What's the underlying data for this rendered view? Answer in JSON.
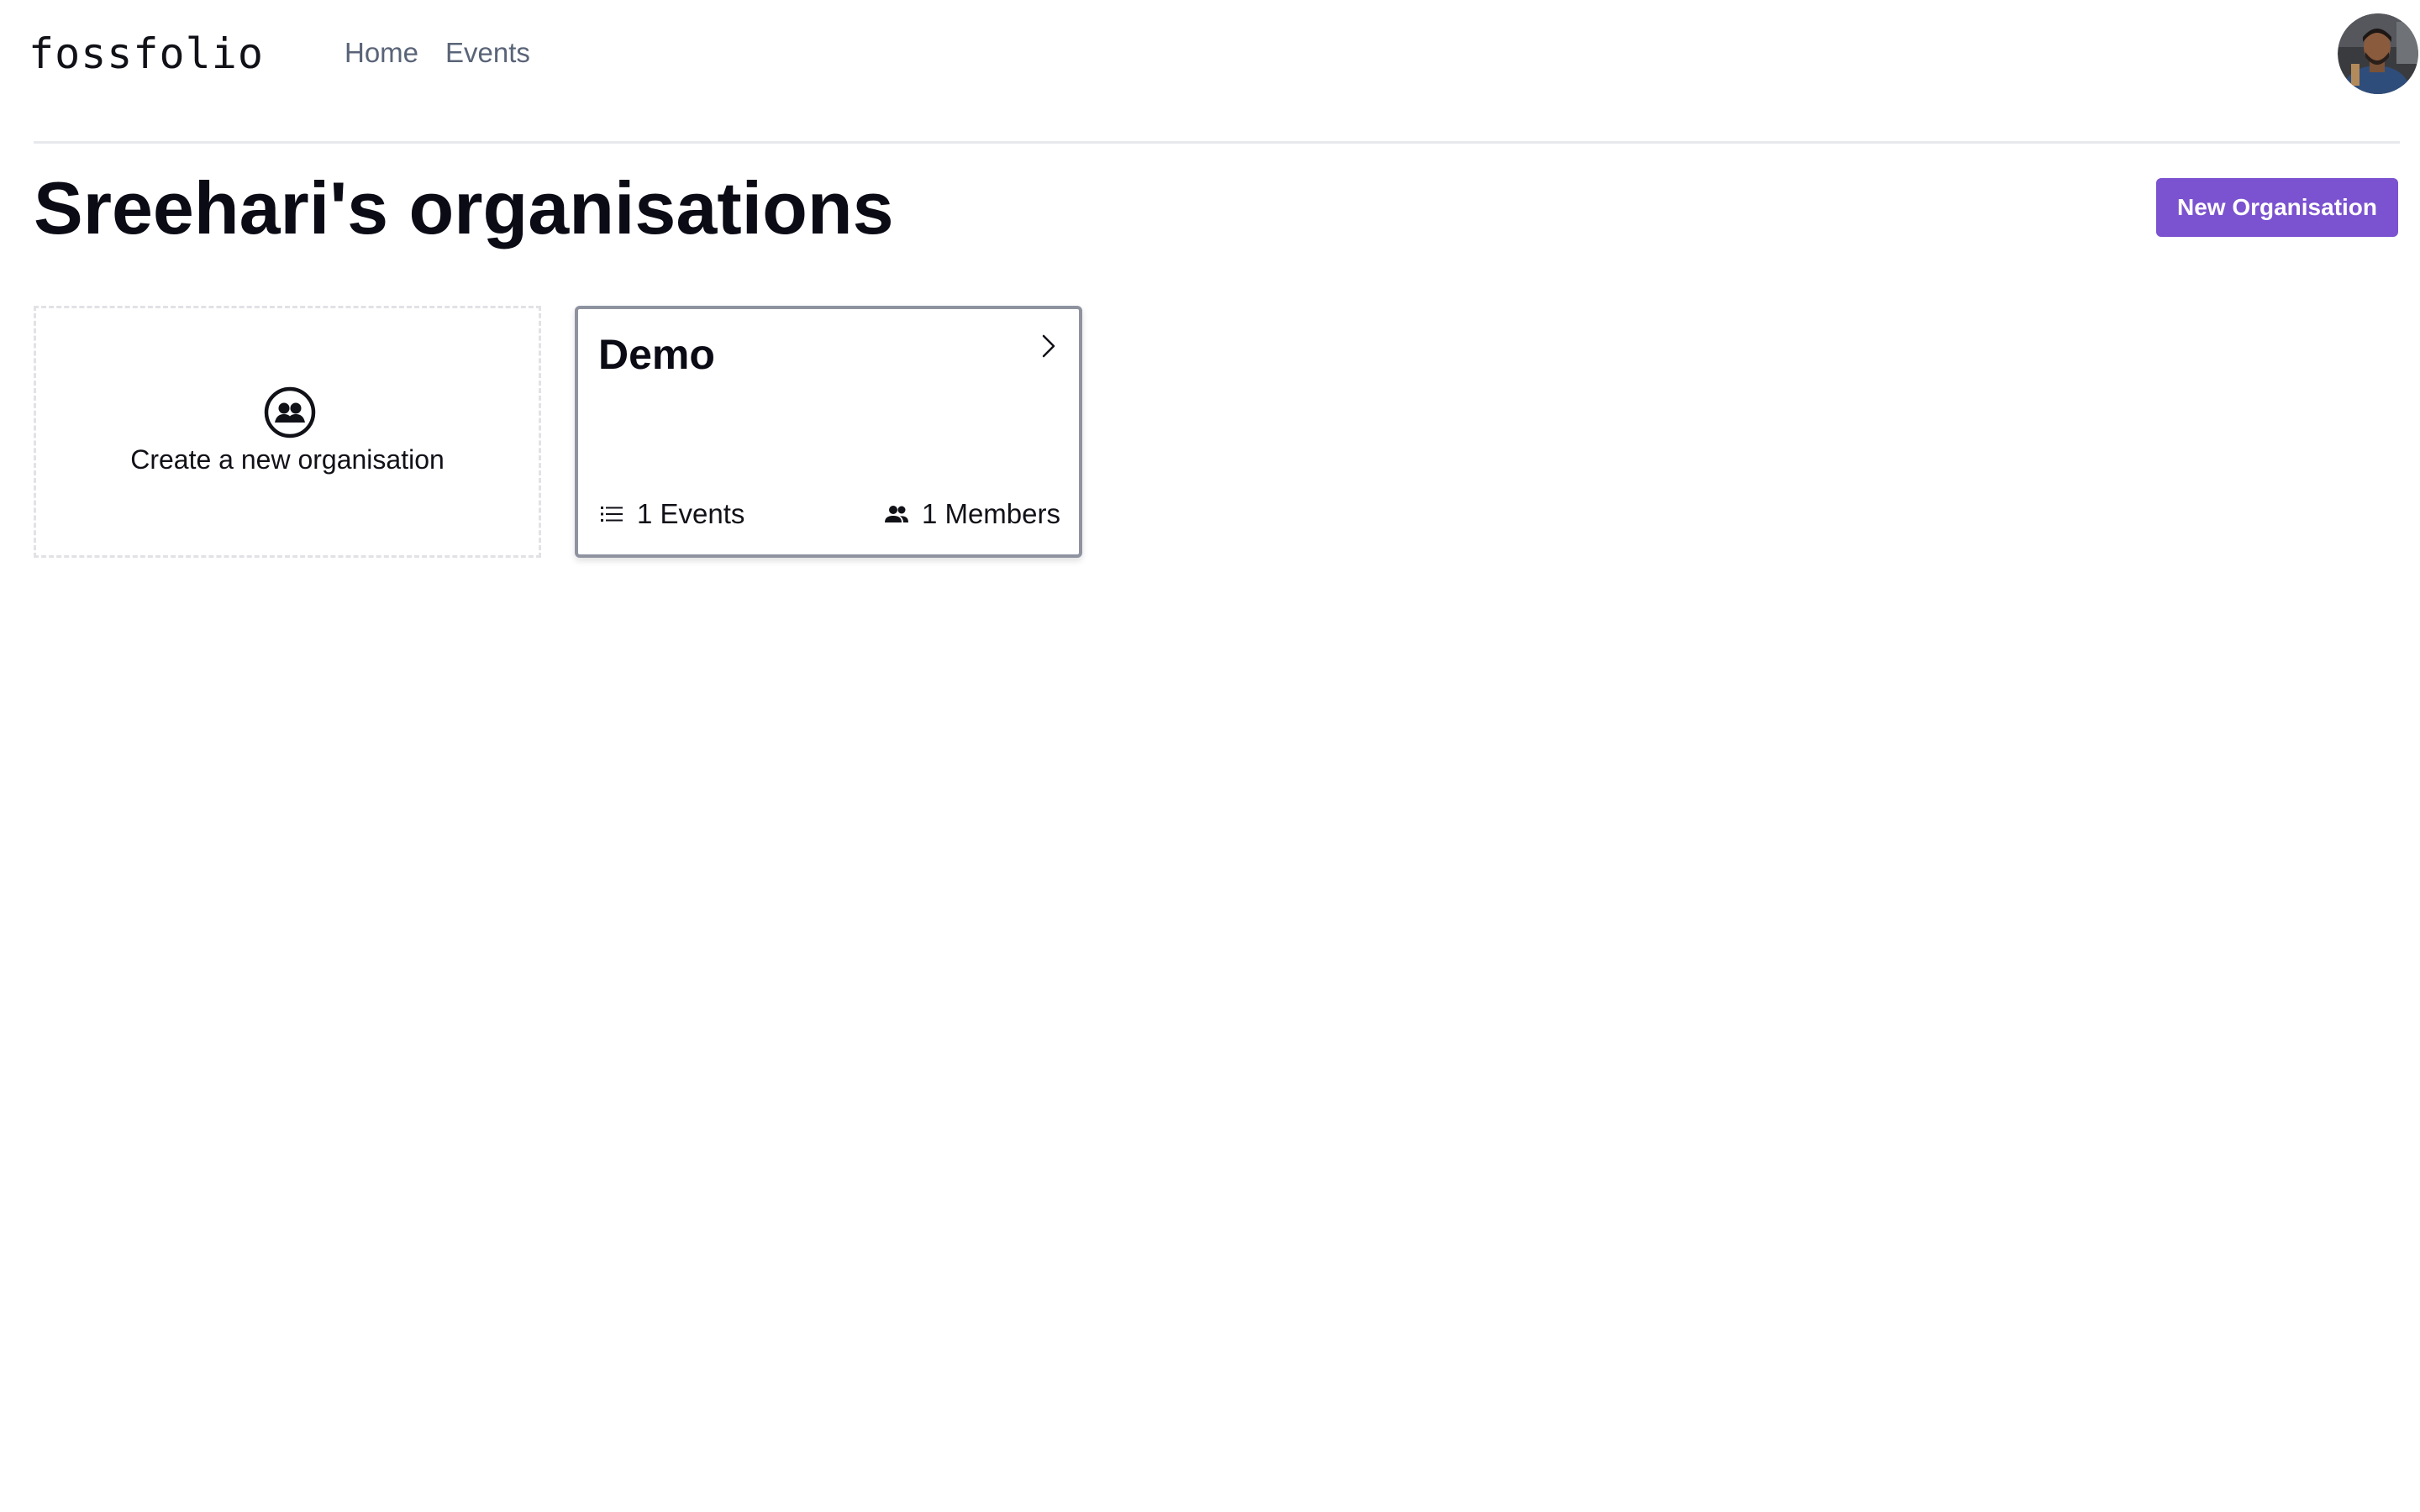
{
  "header": {
    "logo": "fossfolio",
    "nav": [
      {
        "label": "Home"
      },
      {
        "label": "Events"
      }
    ],
    "avatar_icon": "user-avatar"
  },
  "page": {
    "title": "Sreehari's organisations",
    "new_button_label": "New Organisation"
  },
  "create_card": {
    "label": "Create a new organisation",
    "icon": "group-icon"
  },
  "organisations": [
    {
      "name": "Demo",
      "events_label": "1 Events",
      "members_label": "1 Members",
      "events_icon": "list-icon",
      "members_icon": "people-icon",
      "chevron_icon": "chevron-right-icon"
    }
  ],
  "colors": {
    "accent": "#7b52cf",
    "nav_text": "#5a6478",
    "divider": "#e6e8ec"
  }
}
